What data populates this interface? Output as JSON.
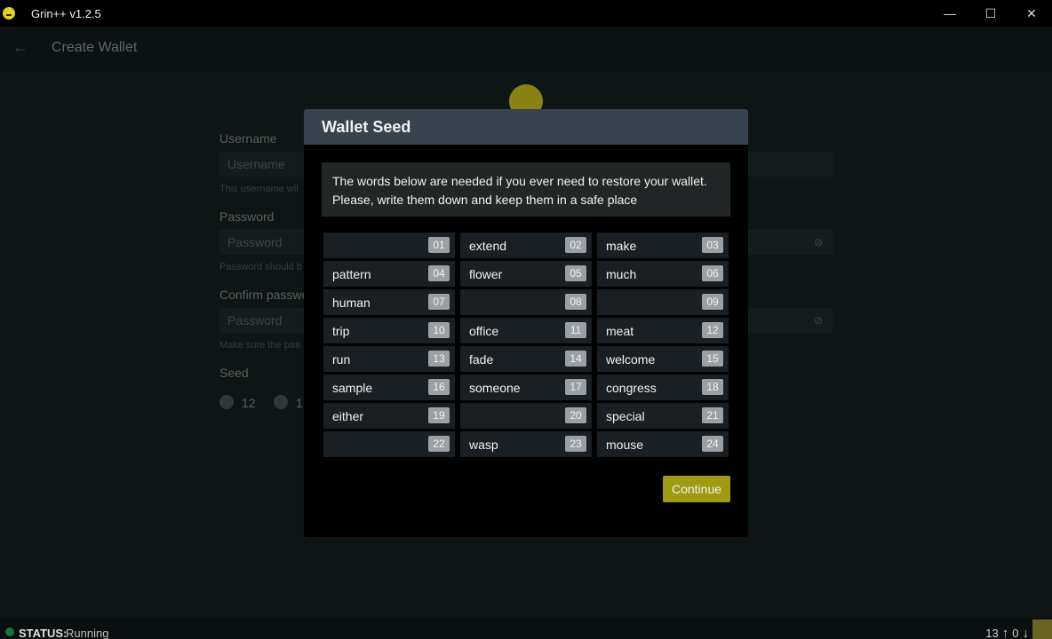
{
  "window": {
    "title": "Grin++ v1.2.5",
    "controls": {
      "minimize": "—",
      "maximize": "☐",
      "close": "✕"
    }
  },
  "header": {
    "title": "Create Wallet",
    "back_icon": "arrow-left-icon"
  },
  "form": {
    "username_label": "Username",
    "username_placeholder": "Username",
    "username_hint": "This username wil",
    "password_label": "Password",
    "password_placeholder": "Password",
    "password_hint": "Password should b",
    "confirm_label": "Confirm passwo",
    "confirm_placeholder": "Password",
    "confirm_hint": "Make sure the pas",
    "seed_label": "Seed",
    "seed_option_12": "12",
    "seed_option_24": "1"
  },
  "modal": {
    "title": "Wallet Seed",
    "info_line1": "The words below are needed if you ever need to restore your wallet.",
    "info_line2": "Please, write them down and keep them in a safe place",
    "words": [
      {
        "word": "",
        "num": "01"
      },
      {
        "word": "extend",
        "num": "02"
      },
      {
        "word": "make",
        "num": "03"
      },
      {
        "word": "pattern",
        "num": "04"
      },
      {
        "word": "flower",
        "num": "05"
      },
      {
        "word": "much",
        "num": "06"
      },
      {
        "word": "human",
        "num": "07"
      },
      {
        "word": "",
        "num": "08"
      },
      {
        "word": "",
        "num": "09"
      },
      {
        "word": "trip",
        "num": "10"
      },
      {
        "word": "office",
        "num": "11"
      },
      {
        "word": "meat",
        "num": "12"
      },
      {
        "word": "run",
        "num": "13"
      },
      {
        "word": "fade",
        "num": "14"
      },
      {
        "word": "welcome",
        "num": "15"
      },
      {
        "word": "sample",
        "num": "16"
      },
      {
        "word": "someone",
        "num": "17"
      },
      {
        "word": "congress",
        "num": "18"
      },
      {
        "word": "either",
        "num": "19"
      },
      {
        "word": "",
        "num": "20"
      },
      {
        "word": "special",
        "num": "21"
      },
      {
        "word": "",
        "num": "22"
      },
      {
        "word": "wasp",
        "num": "23"
      },
      {
        "word": "mouse",
        "num": "24"
      }
    ],
    "continue_label": "Continue"
  },
  "status": {
    "label": "STATUS:",
    "value": "Running",
    "peers_up": "13",
    "peers_down": "0"
  },
  "colors": {
    "accent": "#a09a13",
    "modal_header": "#37434d",
    "status_ok": "#1e6e3a"
  }
}
